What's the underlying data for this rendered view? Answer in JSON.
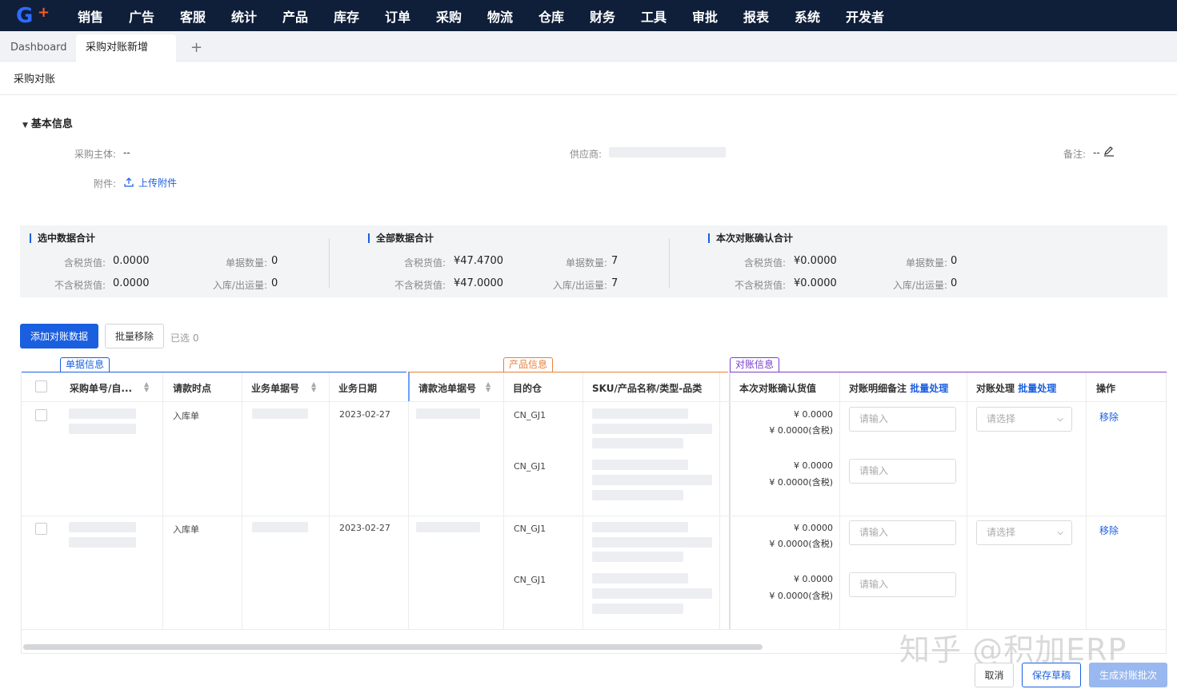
{
  "nav": {
    "items": [
      "销售",
      "广告",
      "客服",
      "统计",
      "产品",
      "库存",
      "订单",
      "采购",
      "物流",
      "仓库",
      "财务",
      "工具",
      "审批",
      "报表",
      "系统",
      "开发者"
    ]
  },
  "tabs": {
    "dashboard": "Dashboard",
    "active": "采购对账新增",
    "add": "+"
  },
  "page_title": "采购对账",
  "basic_info": {
    "heading": "基本信息",
    "subject_label": "采购主体:",
    "subject_value": "--",
    "supplier_label": "供应商:",
    "remark_label": "备注:",
    "remark_value": "--",
    "attachment_label": "附件:",
    "upload_label": "上传附件"
  },
  "summary": {
    "selected": {
      "title": "选中数据合计",
      "tax_incl_label": "含税货值:",
      "tax_incl": "0.0000",
      "tax_excl_label": "不含税货值:",
      "tax_excl": "0.0000",
      "doc_count_label": "单据数量:",
      "doc_count": "0",
      "qty_label": "入库/出运量:",
      "qty": "0"
    },
    "all": {
      "title": "全部数据合计",
      "tax_incl_label": "含税货值:",
      "tax_incl": "¥47.4700",
      "tax_excl_label": "不含税货值:",
      "tax_excl": "¥47.0000",
      "doc_count_label": "单据数量:",
      "doc_count": "7",
      "qty_label": "入库/出运量:",
      "qty": "7"
    },
    "confirm": {
      "title": "本次对账确认合计",
      "tax_incl_label": "含税货值:",
      "tax_incl": "¥0.0000",
      "tax_excl_label": "不含税货值:",
      "tax_excl": "¥0.0000",
      "doc_count_label": "单据数量:",
      "doc_count": "0",
      "qty_label": "入库/出运量:",
      "qty": "0"
    }
  },
  "toolbar": {
    "add_label": "添加对账数据",
    "batch_remove_label": "批量移除",
    "selected_label": "已选 0"
  },
  "groups": {
    "doc": "单据信息",
    "product": "产品信息",
    "recon": "对账信息"
  },
  "columns": {
    "po_no": "采购单号/自...",
    "request_point": "请款时点",
    "biz_no": "业务单据号",
    "biz_date": "业务日期",
    "pool_no": "请款池单据号",
    "warehouse": "目的仓",
    "sku": "SKU/产品名称/类型-品类",
    "confirm_value": "本次对账确认货值",
    "detail_remark": "对账明细备注",
    "batch_1": "批量处理",
    "process": "对账处理",
    "batch_2": "批量处理",
    "action": "操作"
  },
  "rows": [
    {
      "request_point": "入库单",
      "biz_date": "2023-02-27",
      "lines": [
        {
          "warehouse": "CN_GJ1",
          "amount": "¥ 0.0000",
          "amount_tax": "¥ 0.0000(含税)",
          "remark_placeholder": "请输入"
        },
        {
          "warehouse": "CN_GJ1",
          "amount": "¥ 0.0000",
          "amount_tax": "¥ 0.0000(含税)",
          "remark_placeholder": "请输入"
        }
      ],
      "process_placeholder": "请选择",
      "action": "移除"
    },
    {
      "request_point": "入库单",
      "biz_date": "2023-02-27",
      "lines": [
        {
          "warehouse": "CN_GJ1",
          "amount": "¥ 0.0000",
          "amount_tax": "¥ 0.0000(含税)",
          "remark_placeholder": "请输入"
        },
        {
          "warehouse": "CN_GJ1",
          "amount": "¥ 0.0000",
          "amount_tax": "¥ 0.0000(含税)",
          "remark_placeholder": "请输入"
        }
      ],
      "process_placeholder": "请选择",
      "action": "移除"
    }
  ],
  "watermark": "知乎 @积加ERP",
  "footer": {
    "cancel": "取消",
    "save_draft": "保存草稿",
    "generate": "生成对账批次"
  },
  "colors": {
    "nav_bg": "#0f1f3a",
    "primary": "#1a5fe0",
    "group_doc": "#1a5fe0",
    "group_product": "#e8803a",
    "group_recon": "#7a3fc8"
  }
}
